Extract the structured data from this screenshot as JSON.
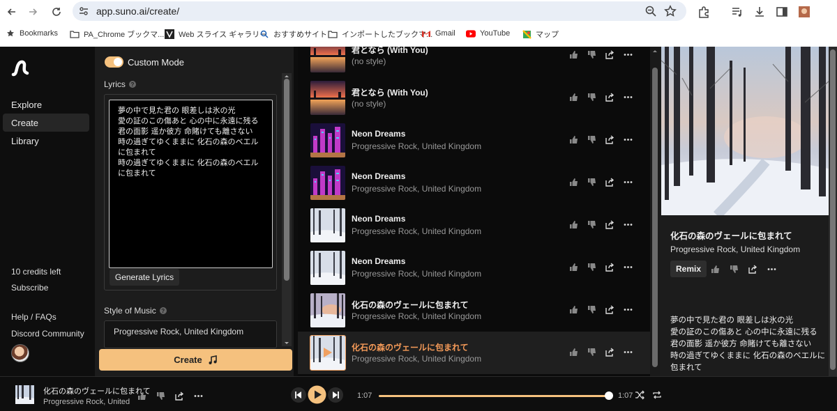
{
  "browser": {
    "url": "app.suno.ai/create/",
    "bookmarks": [
      {
        "label": "Bookmarks",
        "icon": "star-icon"
      },
      {
        "label": "PA_Chrome ブックマ...",
        "icon": "folder-icon"
      },
      {
        "label": "Web スライス ギャラリー",
        "icon": "web-slice-icon"
      },
      {
        "label": "おすすめサイト",
        "icon": "search-icon"
      },
      {
        "label": "インポートしたブックマ...",
        "icon": "folder-icon"
      },
      {
        "label": "Gmail",
        "icon": "gmail-icon"
      },
      {
        "label": "YouTube",
        "icon": "youtube-icon"
      },
      {
        "label": "マップ",
        "icon": "maps-icon"
      }
    ]
  },
  "sidebar": {
    "nav": [
      {
        "label": "Explore",
        "active": false
      },
      {
        "label": "Create",
        "active": true
      },
      {
        "label": "Library",
        "active": false
      }
    ],
    "credits": "10 credits left",
    "subscribe": "Subscribe",
    "help": "Help / FAQs",
    "discord": "Discord Community"
  },
  "create": {
    "custom_mode_label": "Custom Mode",
    "lyrics_label": "Lyrics",
    "lyrics_text": "夢の中で見た君の 眼差しは氷の光\n愛の証のこの傷あと 心の中に永遠に残る\n君の面影 遥か彼方 命賭けても離さない\n時の過ぎてゆくままに 化石の森のベエルに包まれて\n時の過ぎてゆくままに 化石の森のベエルに包まれて",
    "generate_lyrics_label": "Generate Lyrics",
    "style_label": "Style of Music",
    "style_value": "Progressive Rock, United Kingdom",
    "create_button_label": "Create"
  },
  "songs": [
    {
      "title": "君となら (With You)",
      "subtitle": "(no style)",
      "thumb": "sunset-lake"
    },
    {
      "title": "君となら (With You)",
      "subtitle": "(no style)",
      "thumb": "sunset-lake"
    },
    {
      "title": "Neon Dreams",
      "subtitle": "Progressive Rock, United Kingdom",
      "thumb": "neon-city"
    },
    {
      "title": "Neon Dreams",
      "subtitle": "Progressive Rock, United Kingdom",
      "thumb": "neon-city"
    },
    {
      "title": "Neon Dreams",
      "subtitle": "Progressive Rock, United Kingdom",
      "thumb": "snow-forest"
    },
    {
      "title": "Neon Dreams",
      "subtitle": "Progressive Rock, United Kingdom",
      "thumb": "snow-forest"
    },
    {
      "title": "化石の森のヴェールに包まれて",
      "subtitle": "Progressive Rock, United Kingdom",
      "thumb": "snow-forest-dusk"
    },
    {
      "title": "化石の森のヴェールに包まれて",
      "subtitle": "Progressive Rock, United Kingdom",
      "thumb": "snow-forest",
      "active": true
    }
  ],
  "detail": {
    "title": "化石の森のヴェールに包まれて",
    "subtitle": "Progressive Rock, United Kingdom",
    "remix_label": "Remix",
    "lyrics": "夢の中で見た君の 眼差しは氷の光\n愛の証のこの傷あと 心の中に永遠に残る\n君の面影 遥か彼方 命賭けても離さない\n時の過ぎてゆくままに 化石の森のベエルに包まれて"
  },
  "player": {
    "title": "化石の森のヴェールに包まれて",
    "subtitle": "Progressive Rock, United",
    "current_time": "1:07",
    "total_time": "1:07",
    "progress": 1.0
  },
  "colors": {
    "accent": "#f5c17e",
    "active_title": "#f59a58"
  }
}
